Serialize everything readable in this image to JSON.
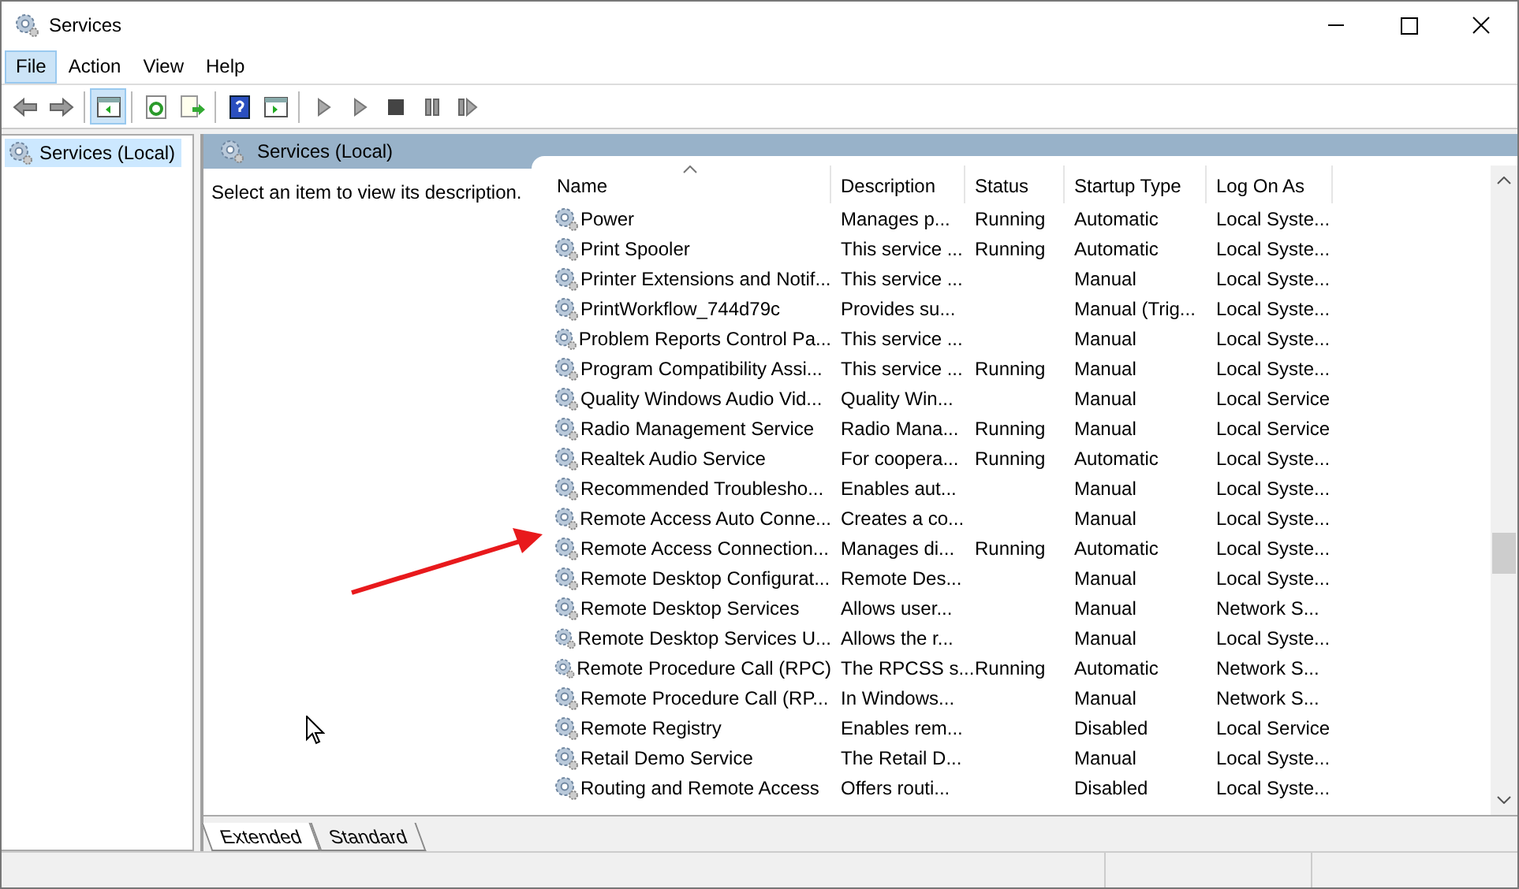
{
  "window": {
    "title": "Services"
  },
  "menu": [
    {
      "label": "File",
      "selected": true
    },
    {
      "label": "Action",
      "selected": false
    },
    {
      "label": "View",
      "selected": false
    },
    {
      "label": "Help",
      "selected": false
    }
  ],
  "toolbar": [
    {
      "kind": "back",
      "selected": false
    },
    {
      "kind": "forward",
      "selected": false
    },
    {
      "kind": "separator"
    },
    {
      "kind": "console-tree",
      "selected": true
    },
    {
      "kind": "separator"
    },
    {
      "kind": "refresh",
      "selected": false
    },
    {
      "kind": "export",
      "selected": false
    },
    {
      "kind": "separator"
    },
    {
      "kind": "help",
      "selected": false
    },
    {
      "kind": "pane",
      "selected": false
    },
    {
      "kind": "separator"
    },
    {
      "kind": "start",
      "selected": false
    },
    {
      "kind": "start",
      "selected": false
    },
    {
      "kind": "stop",
      "selected": false
    },
    {
      "kind": "pause",
      "selected": false
    },
    {
      "kind": "resume",
      "selected": false
    }
  ],
  "tree": [
    {
      "label": "Services (Local)",
      "selected": true
    }
  ],
  "panel": {
    "title": "Services (Local)",
    "description": "Select an item to view its description."
  },
  "table": {
    "columns": [
      "Name",
      "Description",
      "Status",
      "Startup Type",
      "Log On As"
    ],
    "rows": [
      [
        "Power",
        "Manages p...",
        "Running",
        "Automatic",
        "Local Syste..."
      ],
      [
        "Print Spooler",
        "This service ...",
        "Running",
        "Automatic",
        "Local Syste..."
      ],
      [
        "Printer Extensions and Notif...",
        "This service ...",
        "",
        "Manual",
        "Local Syste..."
      ],
      [
        "PrintWorkflow_744d79c",
        "Provides su...",
        "",
        "Manual (Trig...",
        "Local Syste..."
      ],
      [
        "Problem Reports Control Pa...",
        "This service ...",
        "",
        "Manual",
        "Local Syste..."
      ],
      [
        "Program Compatibility Assi...",
        "This service ...",
        "Running",
        "Manual",
        "Local Syste..."
      ],
      [
        "Quality Windows Audio Vid...",
        "Quality Win...",
        "",
        "Manual",
        "Local Service"
      ],
      [
        "Radio Management Service",
        "Radio Mana...",
        "Running",
        "Manual",
        "Local Service"
      ],
      [
        "Realtek Audio Service",
        "For coopera...",
        "Running",
        "Automatic",
        "Local Syste..."
      ],
      [
        "Recommended Troublesho...",
        "Enables aut...",
        "",
        "Manual",
        "Local Syste..."
      ],
      [
        "Remote Access Auto Conne...",
        "Creates a co...",
        "",
        "Manual",
        "Local Syste..."
      ],
      [
        "Remote Access Connection...",
        "Manages di...",
        "Running",
        "Automatic",
        "Local Syste..."
      ],
      [
        "Remote Desktop Configurat...",
        "Remote Des...",
        "",
        "Manual",
        "Local Syste..."
      ],
      [
        "Remote Desktop Services",
        "Allows user...",
        "",
        "Manual",
        "Network S..."
      ],
      [
        "Remote Desktop Services U...",
        "Allows the r...",
        "",
        "Manual",
        "Local Syste..."
      ],
      [
        "Remote Procedure Call (RPC)",
        "The RPCSS s...",
        "Running",
        "Automatic",
        "Network S..."
      ],
      [
        "Remote Procedure Call (RP...",
        "In Windows...",
        "",
        "Manual",
        "Network S..."
      ],
      [
        "Remote Registry",
        "Enables rem...",
        "",
        "Disabled",
        "Local Service"
      ],
      [
        "Retail Demo Service",
        "The Retail D...",
        "",
        "Manual",
        "Local Syste..."
      ],
      [
        "Routing and Remote Access",
        "Offers routi...",
        "",
        "Disabled",
        "Local Syste..."
      ]
    ]
  },
  "tabs": [
    {
      "label": "Extended",
      "selected": true
    },
    {
      "label": "Standard",
      "selected": false
    }
  ]
}
